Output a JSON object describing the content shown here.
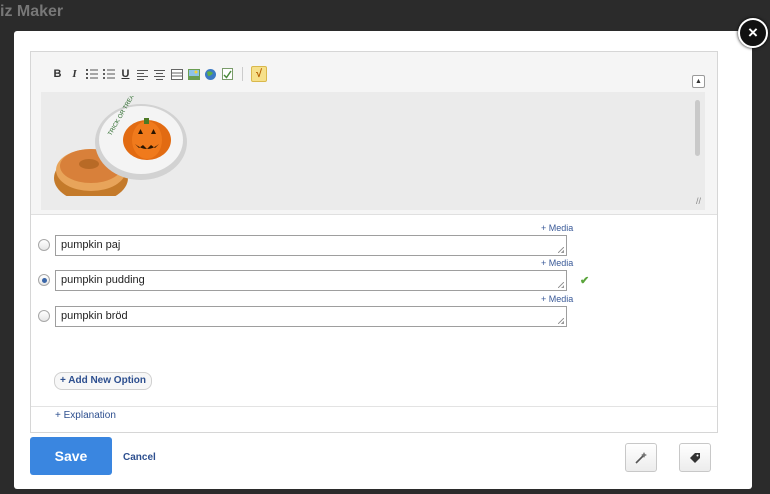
{
  "background": {
    "title": "iz Maker"
  },
  "modal": {
    "close_glyph": "×",
    "toolbar": {
      "items": [
        "bold",
        "italic",
        "ordered-list",
        "unordered-list",
        "underline",
        "align-left",
        "align-center",
        "table",
        "image",
        "link",
        "spellcheck",
        "equation"
      ],
      "bold_label": "B",
      "italic_label": "I",
      "underline_label": "U",
      "equation_label": "√"
    },
    "image_text": "TRICK OR TREAT"
  },
  "options": [
    {
      "media_label": "+ Media",
      "value": "pumpkin paj",
      "selected": false,
      "correct": false
    },
    {
      "media_label": "+ Media",
      "value": "pumpkin pudding",
      "selected": true,
      "correct": true
    },
    {
      "media_label": "+ Media",
      "value": "pumpkin bröd",
      "selected": false,
      "correct": false
    }
  ],
  "correct_mark": "✔",
  "add_option_label": "+ Add New Option",
  "explanation_label": "+ Explanation",
  "footer": {
    "save_label": "Save",
    "cancel_label": "Cancel",
    "tools_icon": "magic-wand-icon",
    "tag_icon": "tag-icon"
  },
  "colors": {
    "save": "#3a86e0",
    "link": "#2d4f8f",
    "check": "#5aa43b"
  }
}
